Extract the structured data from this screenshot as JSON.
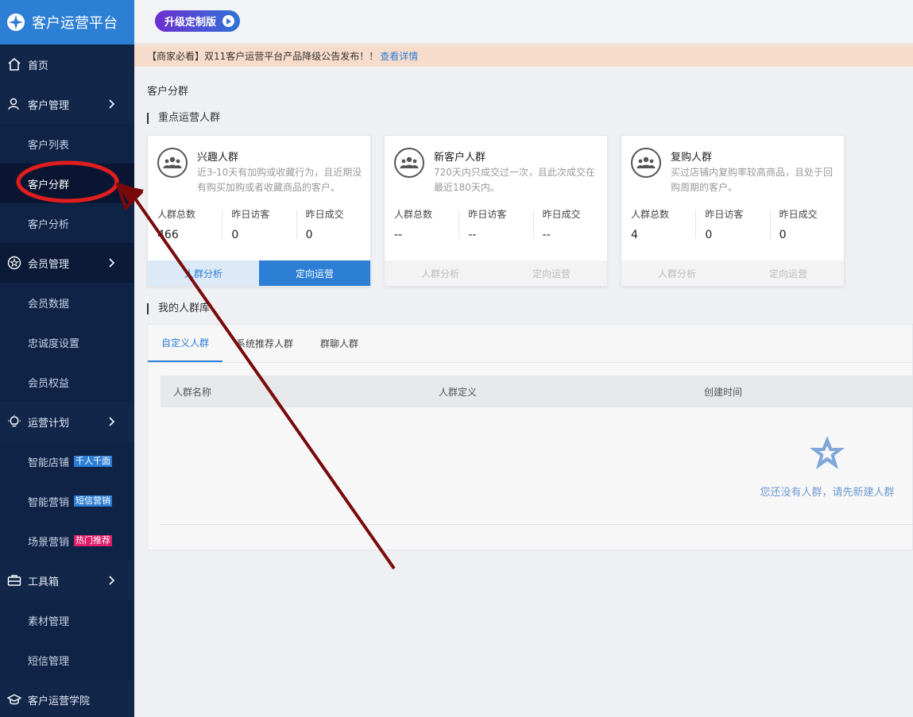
{
  "brand": {
    "title": "客户运营平台"
  },
  "sidebar": {
    "items": [
      {
        "label": "首页"
      },
      {
        "label": "客户管理"
      },
      {
        "label": "客户列表"
      },
      {
        "label": "客户分群"
      },
      {
        "label": "客户分析"
      },
      {
        "label": "会员管理"
      },
      {
        "label": "会员数据"
      },
      {
        "label": "忠诚度设置"
      },
      {
        "label": "会员权益"
      },
      {
        "label": "运营计划"
      },
      {
        "label": "智能店铺",
        "badge": "千人千面"
      },
      {
        "label": "智能营销",
        "badge": "短信营销"
      },
      {
        "label": "场景营销",
        "badge": "热门推荐"
      },
      {
        "label": "工具箱"
      },
      {
        "label": "素材管理"
      },
      {
        "label": "短信管理"
      },
      {
        "label": "客户运营学院"
      }
    ]
  },
  "topbar": {
    "upgrade_label": "升级定制版"
  },
  "notice": {
    "text": "【商家必看】双11客户运营平台产品降级公告发布！！",
    "link": "查看详情"
  },
  "page": {
    "breadcrumb": "客户分群",
    "key_groups_title": "重点运营人群",
    "my_groups_title": "我的人群库"
  },
  "cards": [
    {
      "title": "兴趣人群",
      "desc": "近3-10天有加购或收藏行为，且近期没有购买加购或者收藏商品的客户。",
      "stats": [
        {
          "label": "人群总数",
          "value": "466"
        },
        {
          "label": "昨日访客",
          "value": "0"
        },
        {
          "label": "昨日成交",
          "value": "0"
        }
      ],
      "actions": [
        "人群分析",
        "定向运营"
      ]
    },
    {
      "title": "新客户人群",
      "desc": "720天内只成交过一次，且此次成交在最近180天内。",
      "stats": [
        {
          "label": "人群总数",
          "value": "--"
        },
        {
          "label": "昨日访客",
          "value": "--"
        },
        {
          "label": "昨日成交",
          "value": "--"
        }
      ],
      "actions": [
        "人群分析",
        "定向运营"
      ]
    },
    {
      "title": "复购人群",
      "desc": "买过店铺内复购率较高商品，且处于回购周期的客户。",
      "stats": [
        {
          "label": "人群总数",
          "value": "4"
        },
        {
          "label": "昨日访客",
          "value": "0"
        },
        {
          "label": "昨日成交",
          "value": "0"
        }
      ],
      "actions": [
        "人群分析",
        "定向运营"
      ]
    }
  ],
  "tabs": [
    "自定义人群",
    "系统推荐人群",
    "群聊人群"
  ],
  "table": {
    "columns": [
      "人群名称",
      "人群定义",
      "创建时间"
    ],
    "empty_text": "您还没有人群，请先新建人群"
  },
  "colors": {
    "accent": "#2d7fd6",
    "sidebar": "#12264a",
    "annotation": "#7a0a0a"
  }
}
